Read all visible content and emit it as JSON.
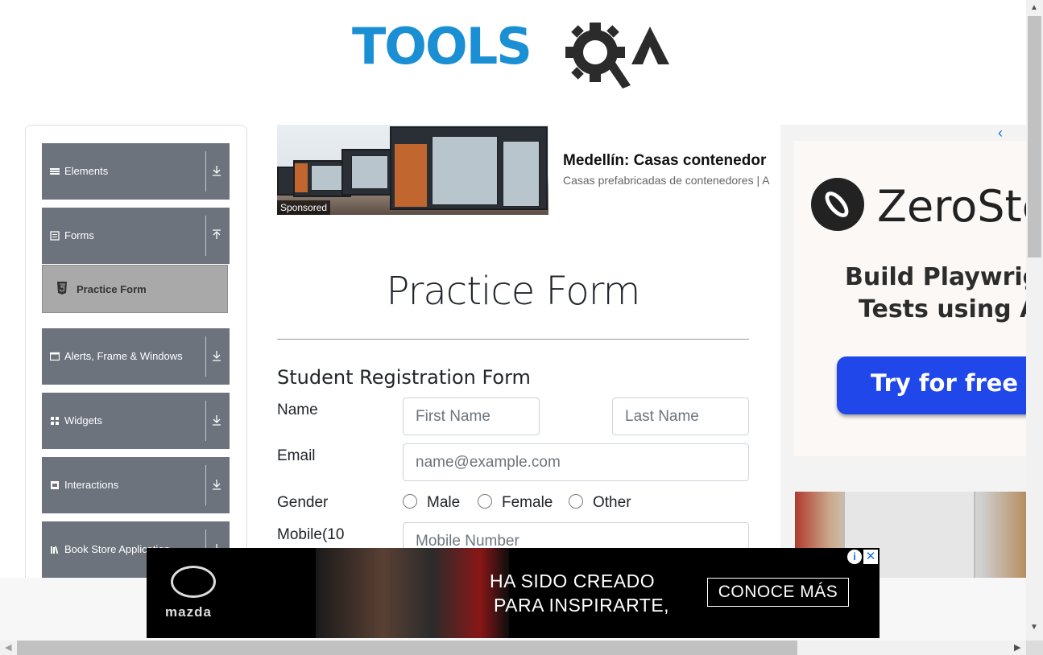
{
  "header": {
    "logo_text": "TOOLSQA",
    "logo_tools": "TOOLS"
  },
  "sidebar": {
    "groups": [
      {
        "label": "Elements",
        "icon": "hamburger-icon"
      },
      {
        "label": "Forms",
        "icon": "form-icon"
      },
      {
        "label": "Alerts, Frame & Windows",
        "icon": "window-icon"
      },
      {
        "label": "Widgets",
        "icon": "grid-icon"
      },
      {
        "label": "Interactions",
        "icon": "interaction-icon"
      },
      {
        "label": "Book Store Application",
        "icon": "library-icon"
      }
    ],
    "active_item": {
      "label": "Practice Form",
      "icon": "html5-icon"
    }
  },
  "top_ad": {
    "badge": "Sponsored",
    "headline": "Medellín: Casas contenedor",
    "subtext": "Casas prefabricadas de contenedores | A"
  },
  "main": {
    "page_title": "Practice Form",
    "form_title": "Student Registration Form",
    "labels": {
      "name": "Name",
      "email": "Email",
      "gender": "Gender",
      "mobile": "Mobile(10"
    },
    "placeholders": {
      "first_name": "First Name",
      "last_name": "Last Name",
      "email": "name@example.com",
      "mobile": "Mobile Number"
    },
    "gender_options": [
      "Male",
      "Female",
      "Other"
    ]
  },
  "right_ad": {
    "brand": "ZeroSte",
    "line1": "Build Playwrigh",
    "line2": "Tests using A",
    "cta": "Try for free →"
  },
  "bottom_ad": {
    "brand": "mazda",
    "line1": "HA SIDO CREADO",
    "line2": "PARA INSPIRARTE,",
    "cta": "CONOCE MÁS",
    "info": "i",
    "close": "✕"
  },
  "colors": {
    "sidebar_group": "#6c737d",
    "active_item": "#a9a9a9",
    "logo_blue": "#1b8fd4",
    "cta_blue": "#1f47ea"
  }
}
